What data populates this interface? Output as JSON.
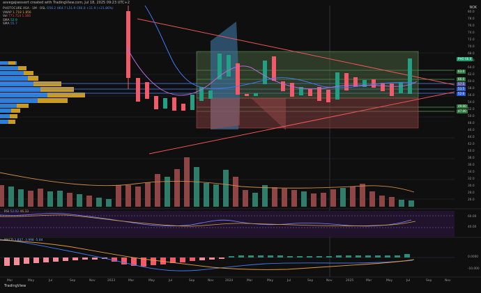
{
  "header": {
    "credit": "asvegajsesvert created with TradingView.com, Jul 18, 2025 09:23 UTC+2",
    "currency": "NOK"
  },
  "legend": {
    "symbol_line": "PHOTOCURE ASA · 1M · OSL",
    "symbol_values": "O56.2  H64.7  L51.9  C66.0  +11.9 (+21.86%)",
    "vwap_name": "VWAP",
    "vwap_values": "1.718  1.856",
    "vol_name": "Vol",
    "vol_values": "771.714  1.366",
    "sma1_name": "SMA",
    "sma1_value": "52.9",
    "sma2_name": "SMA",
    "sma2_value": "55.7"
  },
  "price_axis": [
    "80.0",
    "78.0",
    "76.0",
    "74.0",
    "72.0",
    "70.0",
    "68.0",
    "66.0",
    "64.0",
    "62.0",
    "60.0",
    "58.0",
    "56.0",
    "54.0",
    "52.0",
    "50.0",
    "48.0",
    "46.0",
    "44.0",
    "42.0",
    "40.0",
    "38.0",
    "36.0",
    "34.0",
    "32.0",
    "30.0",
    "28.0",
    "26.0"
  ],
  "price_tags": [
    {
      "label": "PHO 66.0",
      "color": "#1f9a6b"
    },
    {
      "label": "63.0",
      "color": "#2d7a3f"
    },
    {
      "label": "60.0",
      "color": "#2d7a3f"
    },
    {
      "label": "57.5",
      "color": "#4f56a1"
    },
    {
      "label": "53.5",
      "color": "#2a5bd3"
    },
    {
      "label": "52.6",
      "color": "#2a5bd3"
    },
    {
      "label": "49.00",
      "color": "#2d7a3f"
    },
    {
      "label": "47.00",
      "color": "#2d7a3f"
    }
  ],
  "rsi": {
    "name": "RSI",
    "value1": "52.02",
    "value2": "46.33",
    "axis": [
      "60.00",
      "40.00"
    ]
  },
  "macd": {
    "name": "MACD",
    "values": "1.837  -3.998  -5.84",
    "axis": [
      "0.0000",
      "-10.000"
    ]
  },
  "time_axis": [
    "Mar",
    "May",
    "Jul",
    "Sep",
    "Nov",
    "2023",
    "Mar",
    "May",
    "Jul",
    "Sep",
    "Nov",
    "2024",
    "Mar",
    "May",
    "Jul",
    "Sep",
    "Nov",
    "2025",
    "Mar",
    "May",
    "Jul",
    "Sep",
    "Nov"
  ],
  "brand": "TradingView",
  "colors": {
    "up": "#22a085",
    "down": "#f05a69",
    "trend": "#f05656",
    "box_green": "#5f8f5a",
    "box_red": "#8e4545",
    "vp_blue": "#2e7fd8",
    "vp_gold": "#c99b25"
  }
}
